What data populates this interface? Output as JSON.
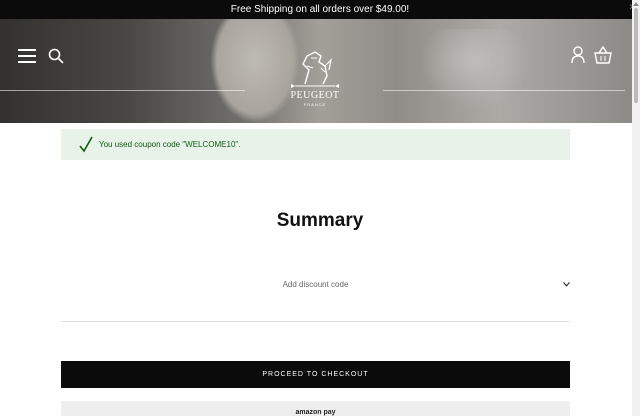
{
  "announcement": {
    "text": "Free Shipping on all orders over $49.00!"
  },
  "header": {
    "logo": {
      "name": "PEUGEOT",
      "sub": "FRANCE"
    }
  },
  "coupon_notice": {
    "text": "You used coupon code \"WELCOME10\"."
  },
  "summary": {
    "title": "Summary",
    "discount_label": "Add discount code",
    "checkout_label": "PROCEED TO CHECKOUT",
    "amazon_pay_label": "amazon pay"
  },
  "colors": {
    "announcement_bg": "#0b0b0b",
    "coupon_bg": "#e8f2e8",
    "coupon_text": "#0f5a12",
    "checkout_bg": "#0b0b0b"
  },
  "icons": [
    "menu-icon",
    "search-icon",
    "account-icon",
    "cart-icon",
    "close-icon",
    "check-icon",
    "chevron-down-icon",
    "lion-logo-icon"
  ]
}
